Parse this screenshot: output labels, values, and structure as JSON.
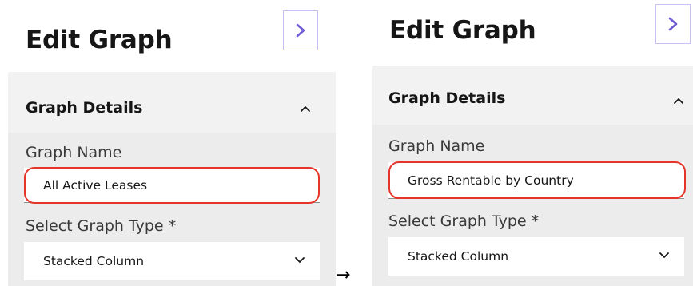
{
  "before": {
    "title": "Edit Graph",
    "section_title": "Graph Details",
    "graph_name_label": "Graph Name",
    "graph_name_value": "All Active Leases",
    "graph_type_label": "Select Graph Type *",
    "graph_type_value": "Stacked Column"
  },
  "after": {
    "title": "Edit Graph",
    "section_title": "Graph Details",
    "graph_name_label": "Graph Name",
    "graph_name_value": "Gross Rentable by Country",
    "graph_type_label": "Select Graph Type *",
    "graph_type_value": "Stacked Column"
  },
  "transition_arrow": "→",
  "icons": {
    "expand": "chevron-right-icon",
    "collapse": "chevron-up-icon",
    "dropdown": "chevron-down-icon"
  },
  "colors": {
    "accent": "#6f5bd6",
    "highlight": "#e5352b",
    "header_bg": "#f2f2f2"
  }
}
